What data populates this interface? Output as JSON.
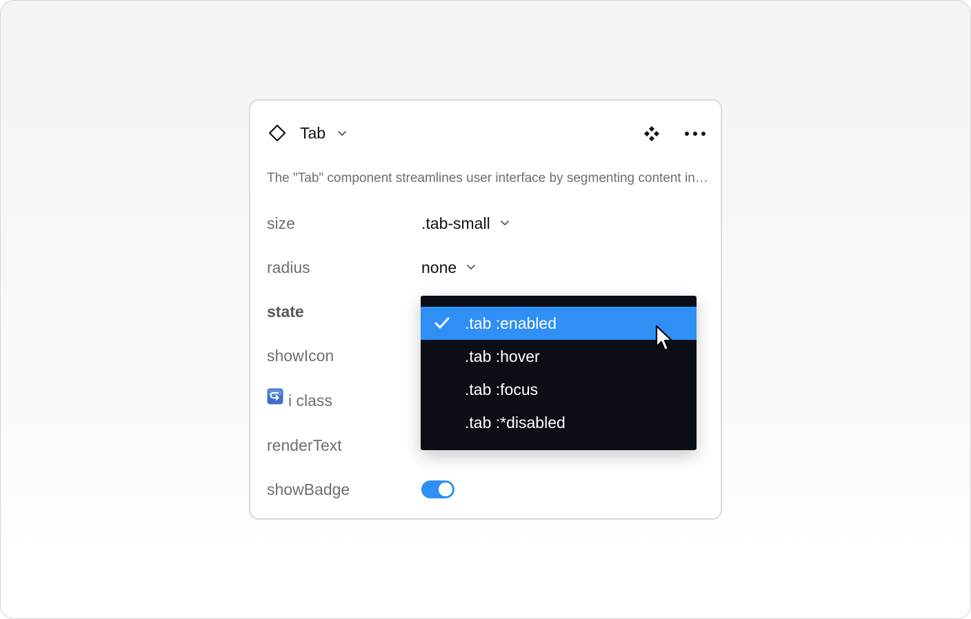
{
  "component": {
    "icon": "diamond-outline-icon",
    "name": "Tab",
    "description": "The \"Tab\" component streamlines user interface by segmenting content into organized sections"
  },
  "header_actions": {
    "variants_icon": "component-variants-icon",
    "more_icon": "more-horizontal-icon"
  },
  "properties": {
    "size": {
      "label": "size",
      "value": ".tab-small"
    },
    "radius": {
      "label": "radius",
      "value": "none"
    },
    "state": {
      "label": "state"
    },
    "showIcon": {
      "label": "showIcon"
    },
    "iclass": {
      "label": "i class",
      "icon": "instance-swap-icon"
    },
    "renderText": {
      "label": "renderText"
    },
    "showBadge": {
      "label": "showBadge",
      "checked": true
    }
  },
  "state_dropdown": {
    "options": [
      {
        "label": ".tab :enabled",
        "selected": true
      },
      {
        "label": ".tab :hover",
        "selected": false
      },
      {
        "label": ".tab :focus",
        "selected": false
      },
      {
        "label": ".tab :*disabled",
        "selected": false
      }
    ]
  },
  "colors": {
    "accent": "#2f8ff5",
    "dropdown_bg": "#0b0f15",
    "label_text": "#6b6e75",
    "value_text": "#111111"
  }
}
